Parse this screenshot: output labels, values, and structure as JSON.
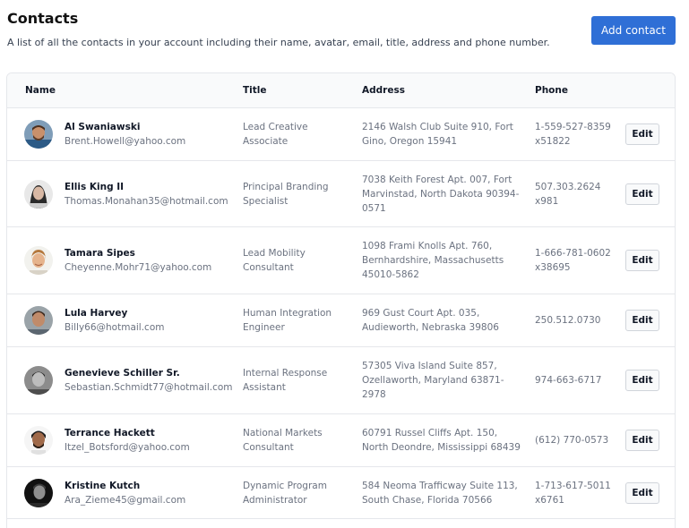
{
  "header": {
    "title": "Contacts",
    "description": "A list of all the contacts in your account including their name, avatar, email, title, address and phone number.",
    "add_button": "Add contact"
  },
  "table": {
    "columns": [
      "Name",
      "Title",
      "Address",
      "Phone"
    ],
    "edit_label": "Edit",
    "rows": [
      {
        "name": "Al Swaniawski",
        "email": "Brent.Howell@yahoo.com",
        "title_lines": [
          "Lead Creative",
          "Associate"
        ],
        "address_lines": [
          "2146 Walsh Club Suite 910, Fort",
          "Gino, Oregon 15941"
        ],
        "phone_lines": [
          "1-559-527-8359",
          "x51822"
        ]
      },
      {
        "name": "Ellis King II",
        "email": "Thomas.Monahan35@hotmail.com",
        "title_lines": [
          "Principal Branding",
          "Specialist"
        ],
        "address_lines": [
          "7038 Keith Forest Apt. 007, Fort",
          "Marvinstad, North Dakota 90394-",
          "0571"
        ],
        "phone_lines": [
          "507.303.2624",
          "x981"
        ]
      },
      {
        "name": "Tamara Sipes",
        "email": "Cheyenne.Mohr71@yahoo.com",
        "title_lines": [
          "Lead Mobility",
          "Consultant"
        ],
        "address_lines": [
          "1098 Frami Knolls Apt. 760,",
          "Bernhardshire, Massachusetts",
          "45010-5862"
        ],
        "phone_lines": [
          "1-666-781-0602",
          "x38695"
        ]
      },
      {
        "name": "Lula Harvey",
        "email": "Billy66@hotmail.com",
        "title_lines": [
          "Human Integration",
          "Engineer"
        ],
        "address_lines": [
          "969 Gust Court Apt. 035,",
          "Audieworth, Nebraska 39806"
        ],
        "phone_lines": [
          "250.512.0730"
        ]
      },
      {
        "name": "Genevieve Schiller Sr.",
        "email": "Sebastian.Schmidt77@hotmail.com",
        "title_lines": [
          "Internal Response",
          "Assistant"
        ],
        "address_lines": [
          "57305 Viva Island Suite 857,",
          "Ozellaworth, Maryland 63871-",
          "2978"
        ],
        "phone_lines": [
          "974-663-6717"
        ]
      },
      {
        "name": "Terrance Hackett",
        "email": "Itzel_Botsford@yahoo.com",
        "title_lines": [
          "National Markets",
          "Consultant"
        ],
        "address_lines": [
          "60791 Russel Cliffs Apt. 150,",
          "North Deondre, Mississippi 68439"
        ],
        "phone_lines": [
          "(612) 770-0573"
        ]
      },
      {
        "name": "Kristine Kutch",
        "email": "Ara_Zieme45@gmail.com",
        "title_lines": [
          "Dynamic Program",
          "Administrator"
        ],
        "address_lines": [
          "584 Neoma Trafficway Suite 113,",
          "South Chase, Florida 70566"
        ],
        "phone_lines": [
          "1-713-617-5011",
          "x6761"
        ]
      }
    ]
  }
}
